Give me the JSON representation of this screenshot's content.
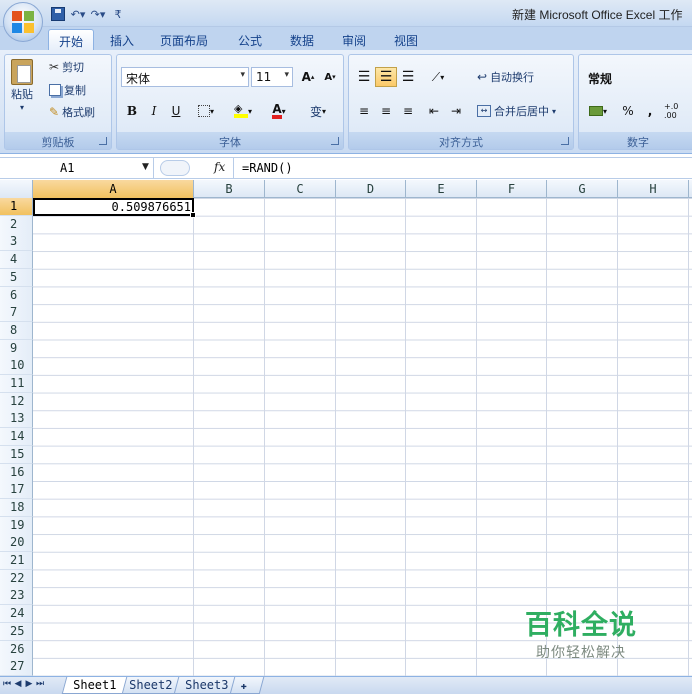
{
  "window": {
    "title": "新建 Microsoft Office Excel 工作"
  },
  "qat": {
    "undo": "↶",
    "redo": "↷",
    "dropdown": "▾",
    "more": "₹"
  },
  "tabs": [
    "开始",
    "插入",
    "页面布局",
    "公式",
    "数据",
    "审阅",
    "视图"
  ],
  "active_tab": "开始",
  "ribbon": {
    "clipboard": {
      "label": "剪贴板",
      "paste": "粘贴",
      "cut": "剪切",
      "copy": "复制",
      "format_painter": "格式刷"
    },
    "font": {
      "label": "字体",
      "font_name": "宋体",
      "font_size": "11",
      "bold": "B",
      "italic": "I",
      "underline": "U",
      "grow": "A",
      "shrink": "A",
      "font_color_letter": "A",
      "phonetic": "变"
    },
    "alignment": {
      "label": "对齐方式",
      "wrap_text": "自动换行",
      "merge_center": "合并后居中"
    },
    "number": {
      "label": "数字",
      "format": "常规",
      "percent": "%",
      "comma": ",",
      "decimal": "+.0 .00"
    }
  },
  "formula_bar": {
    "name_box": "A1",
    "fx": "fx",
    "formula": "=RAND()"
  },
  "grid": {
    "columns": [
      "A",
      "B",
      "C",
      "D",
      "E",
      "F",
      "G",
      "H"
    ],
    "selected_column": "A",
    "rows": [
      "1",
      "2",
      "3",
      "4",
      "5",
      "6",
      "7",
      "8",
      "9",
      "10",
      "11",
      "12",
      "13",
      "14",
      "15",
      "16",
      "17",
      "18",
      "19",
      "20",
      "21",
      "22",
      "23",
      "24",
      "25",
      "26",
      "27"
    ],
    "selected_row": "1",
    "cell_a1": "0.509876651"
  },
  "watermark": {
    "title": "百科全说",
    "subtitle": "助你轻松解决"
  },
  "sheets": [
    "Sheet1",
    "Sheet2",
    "Sheet3"
  ],
  "active_sheet": "Sheet1",
  "colors": {
    "watermark_green": "#2fae61",
    "ribbon_blue": "#15428b",
    "header_highlight": "#f1c15f"
  }
}
